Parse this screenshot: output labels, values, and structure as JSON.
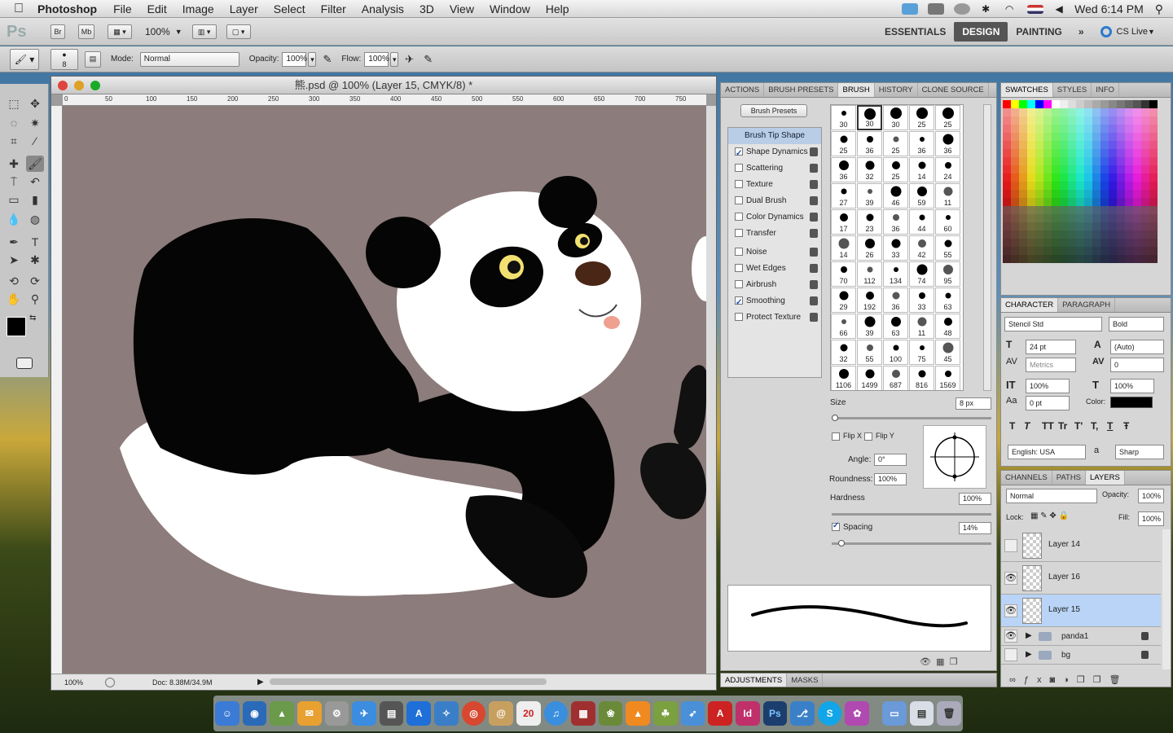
{
  "menubar": {
    "app_name": "Photoshop",
    "items": [
      "File",
      "Edit",
      "Image",
      "Layer",
      "Select",
      "Filter",
      "Analysis",
      "3D",
      "View",
      "Window",
      "Help"
    ],
    "clock": "Wed 6:14 PM"
  },
  "appbar": {
    "ps_logo": "Ps",
    "br": "Br",
    "mb": "Mb",
    "zoom": "100%",
    "workspaces": [
      "ESSENTIALS",
      "DESIGN",
      "PAINTING"
    ],
    "active_workspace": "DESIGN",
    "more": "»",
    "cslive": "CS Live"
  },
  "options": {
    "brush_size": "8",
    "mode_label": "Mode:",
    "mode_value": "Normal",
    "opacity_label": "Opacity:",
    "opacity_value": "100%",
    "flow_label": "Flow:",
    "flow_value": "100%"
  },
  "document": {
    "title": "熊.psd @ 100% (Layer 15, CMYK/8) *",
    "zoom": "100%",
    "doc_info": "Doc: 8.38M/34.9M",
    "ruler_ticks": [
      "0",
      "50",
      "100",
      "150",
      "200",
      "250",
      "300",
      "350",
      "400",
      "450",
      "500",
      "550",
      "600",
      "650",
      "700",
      "750"
    ]
  },
  "brush_panel": {
    "tabs": [
      "ACTIONS",
      "BRUSH PRESETS",
      "BRUSH",
      "HISTORY",
      "CLONE SOURCE"
    ],
    "active_tab": "BRUSH",
    "presets_button": "Brush Presets",
    "tip_shape": "Brush Tip Shape",
    "options": [
      {
        "label": "Shape Dynamics",
        "checked": true
      },
      {
        "label": "Scattering",
        "checked": false
      },
      {
        "label": "Texture",
        "checked": false
      },
      {
        "label": "Dual Brush",
        "checked": false
      },
      {
        "label": "Color Dynamics",
        "checked": false
      },
      {
        "label": "Transfer",
        "checked": false
      },
      {
        "label": "Noise",
        "checked": false
      },
      {
        "label": "Wet Edges",
        "checked": false
      },
      {
        "label": "Airbrush",
        "checked": false
      },
      {
        "label": "Smoothing",
        "checked": true
      },
      {
        "label": "Protect Texture",
        "checked": false
      }
    ],
    "tip_sizes": [
      "30",
      "30",
      "30",
      "25",
      "25",
      "25",
      "36",
      "25",
      "36",
      "36",
      "36",
      "32",
      "25",
      "14",
      "24",
      "27",
      "39",
      "46",
      "59",
      "11",
      "17",
      "23",
      "36",
      "44",
      "60",
      "14",
      "26",
      "33",
      "42",
      "55",
      "70",
      "112",
      "134",
      "74",
      "95",
      "29",
      "192",
      "36",
      "33",
      "63",
      "66",
      "39",
      "63",
      "11",
      "48",
      "32",
      "55",
      "100",
      "75",
      "45",
      "1106",
      "1499",
      "687",
      "816",
      "1569"
    ],
    "size_label": "Size",
    "size_value": "8 px",
    "flip_x": "Flip X",
    "flip_y": "Flip Y",
    "angle_label": "Angle:",
    "angle_value": "0°",
    "roundness_label": "Roundness:",
    "roundness_value": "100%",
    "hardness_label": "Hardness",
    "hardness_value": "100%",
    "spacing_label": "Spacing",
    "spacing_value": "14%",
    "bottom_tabs": [
      "ADJUSTMENTS",
      "MASKS"
    ]
  },
  "swatches_panel": {
    "tabs": [
      "SWATCHES",
      "STYLES",
      "INFO"
    ]
  },
  "character_panel": {
    "tabs": [
      "CHARACTER",
      "PARAGRAPH"
    ],
    "font": "Stencil Std",
    "style": "Bold",
    "size": "24 pt",
    "leading": "(Auto)",
    "kerning": "Metrics",
    "tracking": "0",
    "vscale": "100%",
    "hscale": "100%",
    "baseline": "0 pt",
    "color_label": "Color:",
    "language": "English: USA",
    "aa_label": "a",
    "antialias": "Sharp",
    "type_buttons": [
      "T",
      "T",
      "TT",
      "Tr",
      "T'",
      "T,",
      "T",
      "Ŧ"
    ]
  },
  "layers_panel": {
    "tabs": [
      "CHANNELS",
      "PATHS",
      "LAYERS"
    ],
    "active_tab": "LAYERS",
    "blend": "Normal",
    "opacity_label": "Opacity:",
    "opacity_value": "100%",
    "lock_label": "Lock:",
    "fill_label": "Fill:",
    "fill_value": "100%",
    "layers": [
      {
        "name": "Layer 14",
        "visible": false,
        "selected": false
      },
      {
        "name": "Layer 16",
        "visible": true,
        "selected": false
      },
      {
        "name": "Layer 15",
        "visible": true,
        "selected": true
      }
    ],
    "groups": [
      {
        "name": "panda1",
        "visible": true
      },
      {
        "name": "bg",
        "visible": false
      }
    ]
  },
  "dock": {
    "apps": [
      "Finder",
      "Dashboard",
      "Mail",
      "Safari",
      "iCal",
      "iTunes",
      "Chrome",
      "Acrobat",
      "InDesign",
      "Photoshop",
      "Skype",
      "Trash"
    ]
  }
}
